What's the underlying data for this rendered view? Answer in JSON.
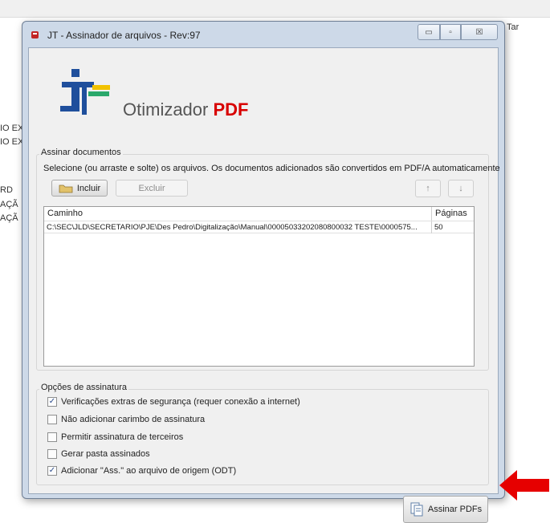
{
  "background": {
    "left_texts": [
      "IO EX",
      "IO EX",
      "RD",
      "AÇÃ",
      "AÇÃ"
    ],
    "right_text": "Tar"
  },
  "window": {
    "title": "JT - Assinador de arquivos - Rev:97",
    "controls": {
      "minimize": "▭",
      "maximize": "▫",
      "close": "☒"
    }
  },
  "logo": {
    "text_plain": "Otimizador ",
    "text_accent": "PDF"
  },
  "documents": {
    "group_label": "Assinar documentos",
    "instruction": "Selecione (ou arraste e solte) os arquivos. Os documentos adicionados são convertidos em PDF/A automaticamente",
    "include_label": "Incluir",
    "exclude_label": "Excluir",
    "up_label": "↑",
    "down_label": "↓",
    "columns": {
      "path": "Caminho",
      "pages": "Páginas"
    },
    "rows": [
      {
        "path": "C:\\SEC\\JLD\\SECRETARIO\\PJE\\Des Pedro\\Digitalização\\Manual\\00005033202080800032 TESTE\\0000575...",
        "pages": "50"
      }
    ]
  },
  "options": {
    "group_label": "Opções de assinatura",
    "items": [
      {
        "label": "Verificações extras de segurança (requer conexão a internet)",
        "checked": true,
        "mark": "✓"
      },
      {
        "label": "Não adicionar carimbo de assinatura",
        "checked": false,
        "mark": ""
      },
      {
        "label": "Permitir assinatura de terceiros",
        "checked": false,
        "mark": ""
      },
      {
        "label": "Gerar pasta assinados",
        "checked": false,
        "mark": ""
      },
      {
        "label": "Adicionar \"Ass.\" ao arquivo de origem (ODT)",
        "checked": true,
        "mark": "✓"
      }
    ]
  },
  "sign_button": {
    "label": "Assinar PDFs"
  },
  "colors": {
    "accent_red": "#e60000",
    "logo_blue": "#1f4f9c",
    "logo_green": "#2aa86b",
    "logo_yellow": "#f2c200"
  }
}
